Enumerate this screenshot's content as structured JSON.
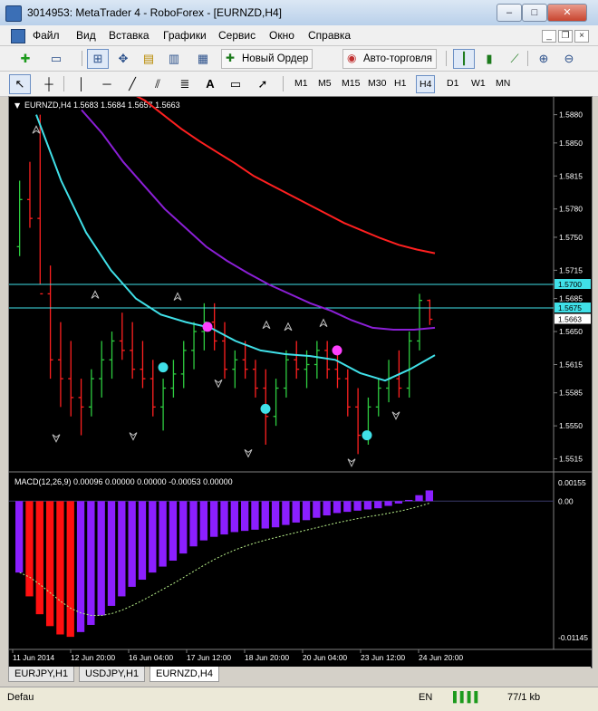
{
  "window": {
    "title": "3014953: MetaTrader 4 - RoboForex - [EURNZD,H4]",
    "min": "–",
    "max": "□",
    "close": "✕"
  },
  "menu": [
    "Файл",
    "Вид",
    "Вставка",
    "Графики",
    "Сервис",
    "Окно",
    "Справка"
  ],
  "toolbar": {
    "new_order": "Новый Ордер",
    "autotrading": "Авто-торговля"
  },
  "timeframes": [
    "M1",
    "M5",
    "M15",
    "M30",
    "H1",
    "H4",
    "D1",
    "W1",
    "MN"
  ],
  "active_timeframe": "H4",
  "chart": {
    "header": "EURNZD,H4  1.5683 1.5684 1.5657 1.5663",
    "price_ticks": [
      "1.5880",
      "1.5850",
      "1.5815",
      "1.5780",
      "1.5750",
      "1.5715",
      "1.5685",
      "1.5650",
      "1.5615",
      "1.5585",
      "1.5550",
      "1.5515"
    ],
    "hline_labels": [
      "1.5700",
      "1.5675"
    ],
    "current_price": "1.5663",
    "time_labels": [
      "11 Jun 2014",
      "12 Jun 20:00",
      "16 Jun 04:00",
      "17 Jun 12:00",
      "18 Jun 20:00",
      "20 Jun 04:00",
      "23 Jun 12:00",
      "24 Jun 20:00"
    ],
    "macd_header": "MACD(12,26,9) 0.00096 0.00000 0.00000 -0.00053 0.00000",
    "macd_ticks": [
      "0.00155",
      "0.00",
      "-0.01145"
    ]
  },
  "chart_data": {
    "type": "line",
    "title": "EURNZD,H4",
    "open": 1.5683,
    "high": 1.5684,
    "low": 1.5657,
    "close": 1.5663,
    "ylim": [
      1.5505,
      1.5895
    ],
    "horizontal_lines": [
      1.57,
      1.5675
    ],
    "candles": [
      [
        1.574,
        1.581,
        1.573,
        1.579
      ],
      [
        1.579,
        1.583,
        1.576,
        1.577
      ],
      [
        1.577,
        1.588,
        1.57,
        1.569
      ],
      [
        1.569,
        1.572,
        1.56,
        1.562
      ],
      [
        1.562,
        1.566,
        1.557,
        1.56
      ],
      [
        1.56,
        1.564,
        1.556,
        1.558
      ],
      [
        1.558,
        1.56,
        1.554,
        1.557
      ],
      [
        1.557,
        1.561,
        1.556,
        1.56
      ],
      [
        1.56,
        1.564,
        1.558,
        1.562
      ],
      [
        1.562,
        1.565,
        1.56,
        1.564
      ],
      [
        1.564,
        1.567,
        1.562,
        1.563
      ],
      [
        1.563,
        1.566,
        1.56,
        1.561
      ],
      [
        1.561,
        1.564,
        1.559,
        1.56
      ],
      [
        1.56,
        1.562,
        1.556,
        1.557
      ],
      [
        1.557,
        1.56,
        1.5545,
        1.559
      ],
      [
        1.559,
        1.562,
        1.558,
        1.5605
      ],
      [
        1.5605,
        1.564,
        1.559,
        1.563
      ],
      [
        1.563,
        1.566,
        1.561,
        1.565
      ],
      [
        1.565,
        1.568,
        1.563,
        1.566
      ],
      [
        1.566,
        1.568,
        1.563,
        1.564
      ],
      [
        1.564,
        1.566,
        1.56,
        1.561
      ],
      [
        1.561,
        1.563,
        1.559,
        1.562
      ],
      [
        1.562,
        1.564,
        1.56,
        1.561
      ],
      [
        1.561,
        1.562,
        1.558,
        1.559
      ],
      [
        1.559,
        1.561,
        1.553,
        1.556
      ],
      [
        1.556,
        1.56,
        1.555,
        1.559
      ],
      [
        1.559,
        1.563,
        1.558,
        1.562
      ],
      [
        1.562,
        1.564,
        1.56,
        1.561
      ],
      [
        1.561,
        1.563,
        1.559,
        1.5615
      ],
      [
        1.5615,
        1.564,
        1.56,
        1.563
      ],
      [
        1.563,
        1.564,
        1.56,
        1.561
      ],
      [
        1.561,
        1.563,
        1.559,
        1.56
      ],
      [
        1.56,
        1.561,
        1.556,
        1.557
      ],
      [
        1.557,
        1.559,
        1.552,
        1.554
      ],
      [
        1.554,
        1.558,
        1.553,
        1.557
      ],
      [
        1.557,
        1.56,
        1.556,
        1.559
      ],
      [
        1.559,
        1.562,
        1.5575,
        1.56
      ],
      [
        1.56,
        1.563,
        1.558,
        1.559
      ],
      [
        1.559,
        1.565,
        1.558,
        1.564
      ],
      [
        1.564,
        1.569,
        1.563,
        1.5683
      ],
      [
        1.5683,
        1.5684,
        1.5657,
        1.5663
      ]
    ],
    "series": [
      {
        "name": "",
        "color": "#ff2020",
        "values": [
          1.5905,
          1.5895,
          1.588,
          1.5865,
          1.5852,
          1.584,
          1.5828,
          1.5815,
          1.5805,
          1.5795,
          1.5785,
          1.5775,
          1.5765,
          1.5757,
          1.5749,
          1.5742,
          1.5737,
          1.5733
        ]
      },
      {
        "name": "",
        "color": "#8b1fd6",
        "values": [
          1.5885,
          1.586,
          1.583,
          1.5805,
          1.578,
          1.576,
          1.574,
          1.5725,
          1.5712,
          1.57,
          1.569,
          1.568,
          1.5672,
          1.5662,
          1.5654,
          1.5652,
          1.5652,
          1.5654
        ]
      },
      {
        "name": "",
        "color": "#40e0e8",
        "values": [
          1.588,
          1.581,
          1.5755,
          1.5715,
          1.5685,
          1.5668,
          1.566,
          1.5654,
          1.564,
          1.563,
          1.5626,
          1.5624,
          1.562,
          1.5606,
          1.5598,
          1.561,
          1.5625
        ]
      }
    ],
    "macd": {
      "values": [
        -0.006,
        -0.008,
        -0.0095,
        -0.0105,
        -0.0112,
        -0.0114,
        -0.011,
        -0.0104,
        -0.0096,
        -0.0088,
        -0.008,
        -0.0072,
        -0.0066,
        -0.006,
        -0.0055,
        -0.005,
        -0.0044,
        -0.0038,
        -0.0033,
        -0.003,
        -0.0028,
        -0.0026,
        -0.0025,
        -0.0024,
        -0.0023,
        -0.0022,
        -0.002,
        -0.0018,
        -0.0016,
        -0.0014,
        -0.0012,
        -0.001,
        -0.0009,
        -0.0008,
        -0.0007,
        -0.0006,
        -0.0004,
        -0.0002,
        0.0001,
        0.0005,
        0.0009
      ],
      "ylim": [
        -0.012,
        0.002
      ]
    }
  },
  "tabs": [
    "EURJPY,H1",
    "USDJPY,H1",
    "EURNZD,H4"
  ],
  "status": {
    "left": "Defau",
    "lang": "EN",
    "traffic": "77/1 kb"
  }
}
